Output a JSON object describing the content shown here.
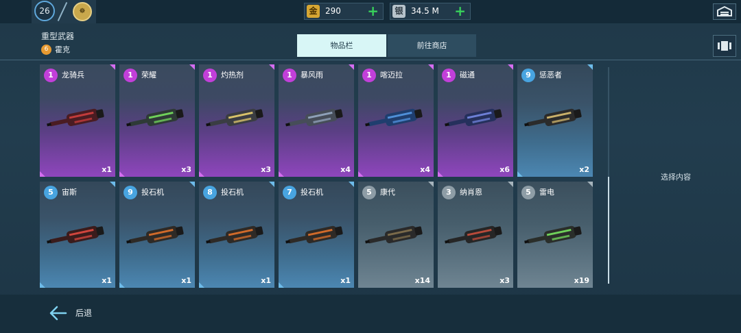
{
  "topbar": {
    "level": "26",
    "rank_glyph": "☸",
    "gold": {
      "icon": "金",
      "value": "290"
    },
    "silver": {
      "icon": "银",
      "value": "34.5 M"
    }
  },
  "header": {
    "category_title": "重型武器",
    "sub_level": "6",
    "sub_title": "霍克"
  },
  "tabs": [
    {
      "label": "物品栏",
      "active": true
    },
    {
      "label": "前往商店",
      "active": false
    }
  ],
  "items": [
    {
      "num": "1",
      "name": "龙骑兵",
      "qty": "x1",
      "rarity": "purple",
      "body": "#4a1c22",
      "accent": "#c23b3b"
    },
    {
      "num": "1",
      "name": "荣耀",
      "qty": "x3",
      "rarity": "purple",
      "body": "#2e3a36",
      "accent": "#6fd05a"
    },
    {
      "num": "1",
      "name": "灼热剂",
      "qty": "x3",
      "rarity": "purple",
      "body": "#3a3d42",
      "accent": "#d8c26a"
    },
    {
      "num": "1",
      "name": "暴风雨",
      "qty": "x4",
      "rarity": "purple",
      "body": "#464d58",
      "accent": "#8ea0b8"
    },
    {
      "num": "1",
      "name": "喀迈拉",
      "qty": "x4",
      "rarity": "purple",
      "body": "#1f3e6e",
      "accent": "#4f8fd8"
    },
    {
      "num": "1",
      "name": "磁通",
      "qty": "x6",
      "rarity": "purple",
      "body": "#25305c",
      "accent": "#6d7fd6"
    },
    {
      "num": "9",
      "name": "惩恶者",
      "qty": "x2",
      "rarity": "blue",
      "body": "#2b2b2b",
      "accent": "#c9b06a"
    },
    {
      "num": "5",
      "name": "宙斯",
      "qty": "x1",
      "rarity": "blue",
      "body": "#3a1c1c",
      "accent": "#d0453d"
    },
    {
      "num": "9",
      "name": "投石机",
      "qty": "x1",
      "rarity": "blue",
      "body": "#2e2a26",
      "accent": "#d06a2a"
    },
    {
      "num": "8",
      "name": "投石机",
      "qty": "x1",
      "rarity": "blue",
      "body": "#2e2a26",
      "accent": "#d06a2a"
    },
    {
      "num": "7",
      "name": "投石机",
      "qty": "x1",
      "rarity": "blue",
      "body": "#2e2a26",
      "accent": "#d06a2a"
    },
    {
      "num": "5",
      "name": "康代",
      "qty": "x14",
      "rarity": "gray",
      "body": "#2a2a2a",
      "accent": "#7a6a4a"
    },
    {
      "num": "3",
      "name": "纳肖恩",
      "qty": "x3",
      "rarity": "gray",
      "body": "#262626",
      "accent": "#b84a3a"
    },
    {
      "num": "5",
      "name": "雷电",
      "qty": "x19",
      "rarity": "gray",
      "body": "#2a2e2a",
      "accent": "#6fd05a"
    }
  ],
  "right_panel": {
    "hint": "选择内容"
  },
  "footer": {
    "back_label": "后退"
  },
  "colors": {
    "accent_green": "#38d25b",
    "tab_active": "#d8f6f6",
    "purple": "#8f46bd",
    "blue": "#4c87b2"
  }
}
